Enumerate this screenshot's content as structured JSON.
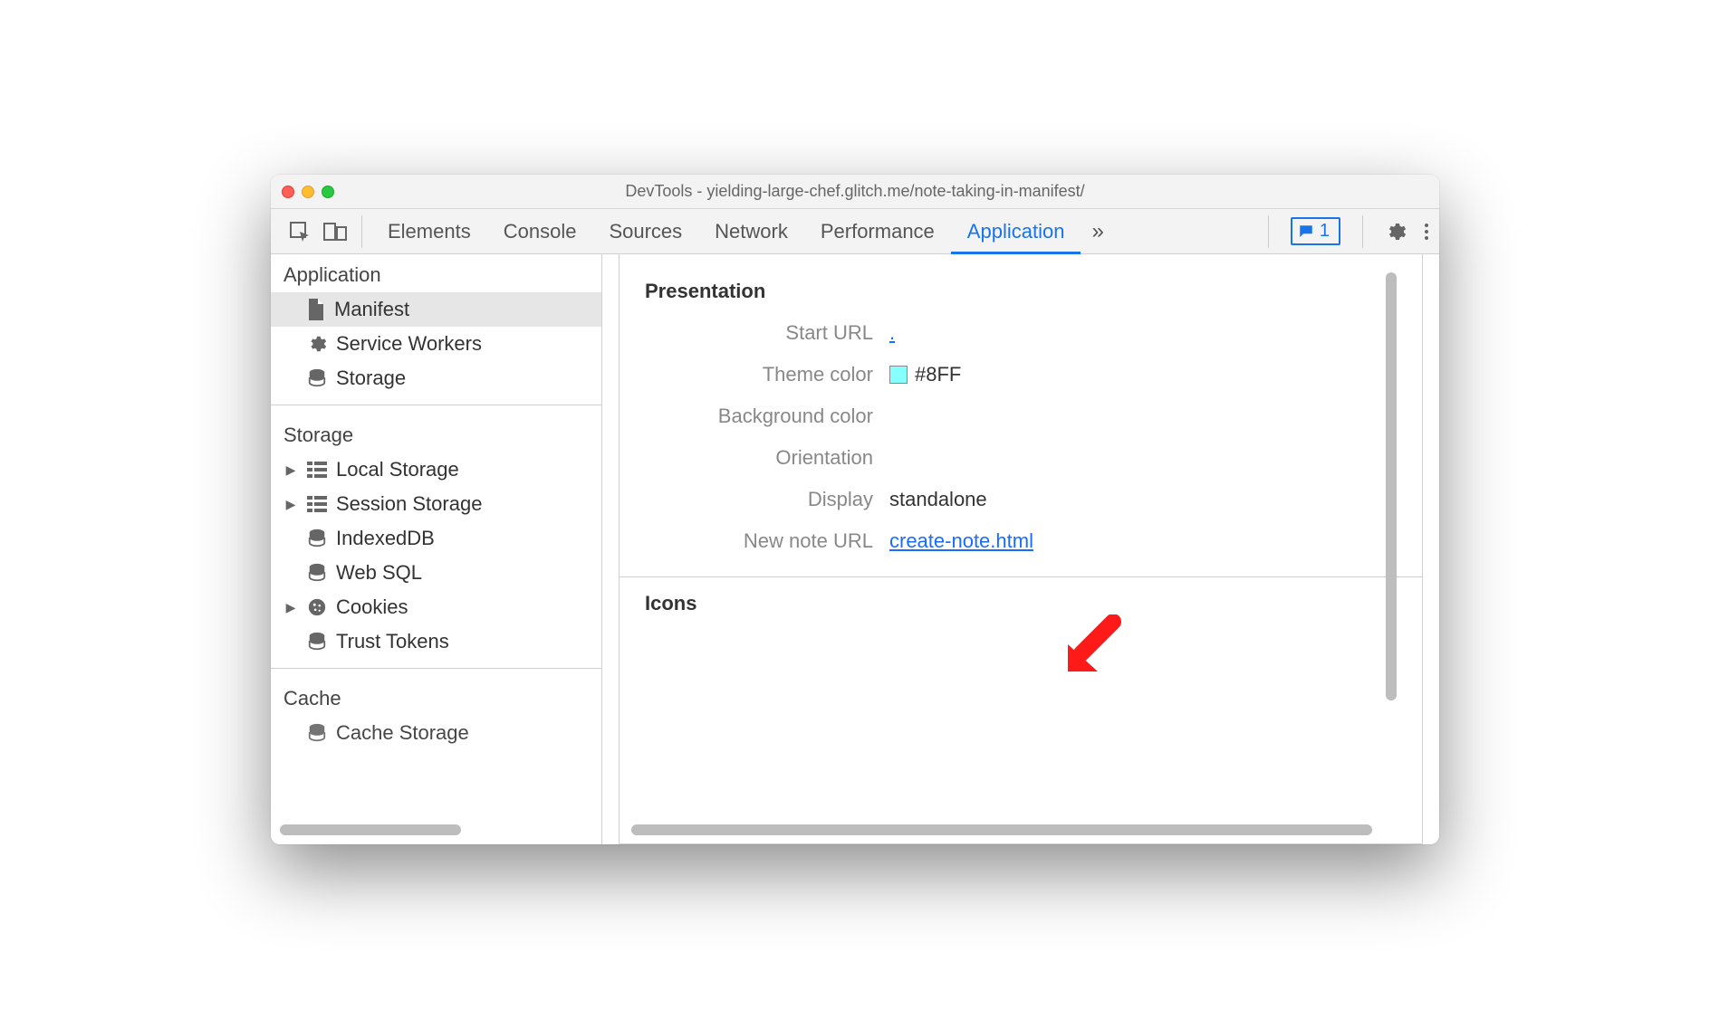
{
  "window": {
    "title": "DevTools - yielding-large-chef.glitch.me/note-taking-in-manifest/"
  },
  "toolbar": {
    "tabs": [
      "Elements",
      "Console",
      "Sources",
      "Network",
      "Performance",
      "Application"
    ],
    "active_tab": "Application",
    "messages_badge": "1"
  },
  "sidebar": {
    "sections": [
      {
        "title": "Application",
        "items": [
          {
            "label": "Manifest",
            "icon": "document",
            "selected": true
          },
          {
            "label": "Service Workers",
            "icon": "gear"
          },
          {
            "label": "Storage",
            "icon": "db"
          }
        ]
      },
      {
        "title": "Storage",
        "items": [
          {
            "label": "Local Storage",
            "icon": "grid",
            "expandable": true
          },
          {
            "label": "Session Storage",
            "icon": "grid",
            "expandable": true
          },
          {
            "label": "IndexedDB",
            "icon": "db"
          },
          {
            "label": "Web SQL",
            "icon": "db"
          },
          {
            "label": "Cookies",
            "icon": "cookie",
            "expandable": true
          },
          {
            "label": "Trust Tokens",
            "icon": "db"
          }
        ]
      },
      {
        "title": "Cache",
        "items": [
          {
            "label": "Cache Storage",
            "icon": "db"
          }
        ]
      }
    ]
  },
  "manifest": {
    "group_presentation": "Presentation",
    "fields": {
      "start_url": {
        "label": "Start URL",
        "value": "."
      },
      "theme_color": {
        "label": "Theme color",
        "value": "#8FF"
      },
      "background_color": {
        "label": "Background color",
        "value": ""
      },
      "orientation": {
        "label": "Orientation",
        "value": ""
      },
      "display": {
        "label": "Display",
        "value": "standalone"
      },
      "new_note_url": {
        "label": "New note URL",
        "value": "create-note.html"
      }
    },
    "group_icons": "Icons"
  }
}
